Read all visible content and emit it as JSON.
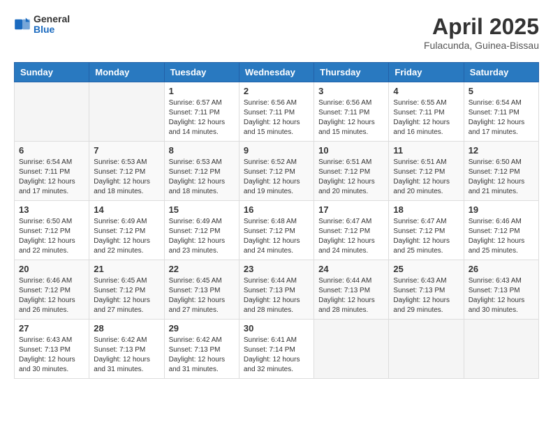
{
  "header": {
    "logo": {
      "general": "General",
      "blue": "Blue"
    },
    "title": "April 2025",
    "location": "Fulacunda, Guinea-Bissau"
  },
  "weekdays": [
    "Sunday",
    "Monday",
    "Tuesday",
    "Wednesday",
    "Thursday",
    "Friday",
    "Saturday"
  ],
  "weeks": [
    [
      {
        "day": null,
        "info": null
      },
      {
        "day": null,
        "info": null
      },
      {
        "day": "1",
        "info": "Sunrise: 6:57 AM\nSunset: 7:11 PM\nDaylight: 12 hours and 14 minutes."
      },
      {
        "day": "2",
        "info": "Sunrise: 6:56 AM\nSunset: 7:11 PM\nDaylight: 12 hours and 15 minutes."
      },
      {
        "day": "3",
        "info": "Sunrise: 6:56 AM\nSunset: 7:11 PM\nDaylight: 12 hours and 15 minutes."
      },
      {
        "day": "4",
        "info": "Sunrise: 6:55 AM\nSunset: 7:11 PM\nDaylight: 12 hours and 16 minutes."
      },
      {
        "day": "5",
        "info": "Sunrise: 6:54 AM\nSunset: 7:11 PM\nDaylight: 12 hours and 17 minutes."
      }
    ],
    [
      {
        "day": "6",
        "info": "Sunrise: 6:54 AM\nSunset: 7:11 PM\nDaylight: 12 hours and 17 minutes."
      },
      {
        "day": "7",
        "info": "Sunrise: 6:53 AM\nSunset: 7:12 PM\nDaylight: 12 hours and 18 minutes."
      },
      {
        "day": "8",
        "info": "Sunrise: 6:53 AM\nSunset: 7:12 PM\nDaylight: 12 hours and 18 minutes."
      },
      {
        "day": "9",
        "info": "Sunrise: 6:52 AM\nSunset: 7:12 PM\nDaylight: 12 hours and 19 minutes."
      },
      {
        "day": "10",
        "info": "Sunrise: 6:51 AM\nSunset: 7:12 PM\nDaylight: 12 hours and 20 minutes."
      },
      {
        "day": "11",
        "info": "Sunrise: 6:51 AM\nSunset: 7:12 PM\nDaylight: 12 hours and 20 minutes."
      },
      {
        "day": "12",
        "info": "Sunrise: 6:50 AM\nSunset: 7:12 PM\nDaylight: 12 hours and 21 minutes."
      }
    ],
    [
      {
        "day": "13",
        "info": "Sunrise: 6:50 AM\nSunset: 7:12 PM\nDaylight: 12 hours and 22 minutes."
      },
      {
        "day": "14",
        "info": "Sunrise: 6:49 AM\nSunset: 7:12 PM\nDaylight: 12 hours and 22 minutes."
      },
      {
        "day": "15",
        "info": "Sunrise: 6:49 AM\nSunset: 7:12 PM\nDaylight: 12 hours and 23 minutes."
      },
      {
        "day": "16",
        "info": "Sunrise: 6:48 AM\nSunset: 7:12 PM\nDaylight: 12 hours and 24 minutes."
      },
      {
        "day": "17",
        "info": "Sunrise: 6:47 AM\nSunset: 7:12 PM\nDaylight: 12 hours and 24 minutes."
      },
      {
        "day": "18",
        "info": "Sunrise: 6:47 AM\nSunset: 7:12 PM\nDaylight: 12 hours and 25 minutes."
      },
      {
        "day": "19",
        "info": "Sunrise: 6:46 AM\nSunset: 7:12 PM\nDaylight: 12 hours and 25 minutes."
      }
    ],
    [
      {
        "day": "20",
        "info": "Sunrise: 6:46 AM\nSunset: 7:12 PM\nDaylight: 12 hours and 26 minutes."
      },
      {
        "day": "21",
        "info": "Sunrise: 6:45 AM\nSunset: 7:12 PM\nDaylight: 12 hours and 27 minutes."
      },
      {
        "day": "22",
        "info": "Sunrise: 6:45 AM\nSunset: 7:13 PM\nDaylight: 12 hours and 27 minutes."
      },
      {
        "day": "23",
        "info": "Sunrise: 6:44 AM\nSunset: 7:13 PM\nDaylight: 12 hours and 28 minutes."
      },
      {
        "day": "24",
        "info": "Sunrise: 6:44 AM\nSunset: 7:13 PM\nDaylight: 12 hours and 28 minutes."
      },
      {
        "day": "25",
        "info": "Sunrise: 6:43 AM\nSunset: 7:13 PM\nDaylight: 12 hours and 29 minutes."
      },
      {
        "day": "26",
        "info": "Sunrise: 6:43 AM\nSunset: 7:13 PM\nDaylight: 12 hours and 30 minutes."
      }
    ],
    [
      {
        "day": "27",
        "info": "Sunrise: 6:43 AM\nSunset: 7:13 PM\nDaylight: 12 hours and 30 minutes."
      },
      {
        "day": "28",
        "info": "Sunrise: 6:42 AM\nSunset: 7:13 PM\nDaylight: 12 hours and 31 minutes."
      },
      {
        "day": "29",
        "info": "Sunrise: 6:42 AM\nSunset: 7:13 PM\nDaylight: 12 hours and 31 minutes."
      },
      {
        "day": "30",
        "info": "Sunrise: 6:41 AM\nSunset: 7:14 PM\nDaylight: 12 hours and 32 minutes."
      },
      {
        "day": null,
        "info": null
      },
      {
        "day": null,
        "info": null
      },
      {
        "day": null,
        "info": null
      }
    ]
  ]
}
